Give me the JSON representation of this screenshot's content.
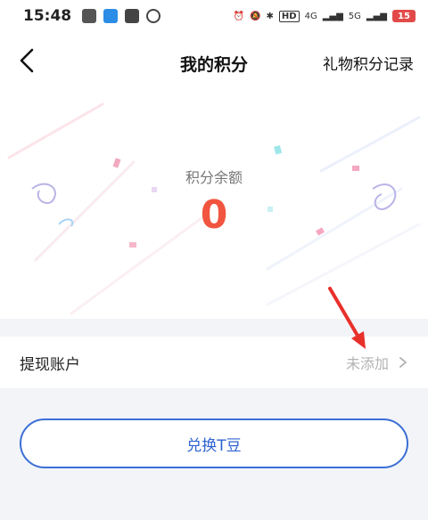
{
  "status_bar": {
    "time": "15:48",
    "network": "4G",
    "network2": "5G",
    "battery": "15",
    "icons": [
      "photo-icon",
      "app-icon",
      "mail-icon",
      "sync-icon",
      "alarm-icon",
      "mute-icon",
      "bluetooth-icon",
      "hd-icon",
      "signal-icon",
      "wifi-icon"
    ]
  },
  "nav": {
    "title": "我的积分",
    "right_link": "礼物积分记录",
    "back_icon": "chevron-left-icon"
  },
  "balance": {
    "label": "积分余额",
    "value": "0"
  },
  "account": {
    "label": "提现账户",
    "status": "未添加"
  },
  "redeem": {
    "label": "兑换T豆"
  },
  "colors": {
    "accent": "#2f64d0",
    "balance": "#f1553f",
    "annotation_arrow": "#e8302b"
  }
}
